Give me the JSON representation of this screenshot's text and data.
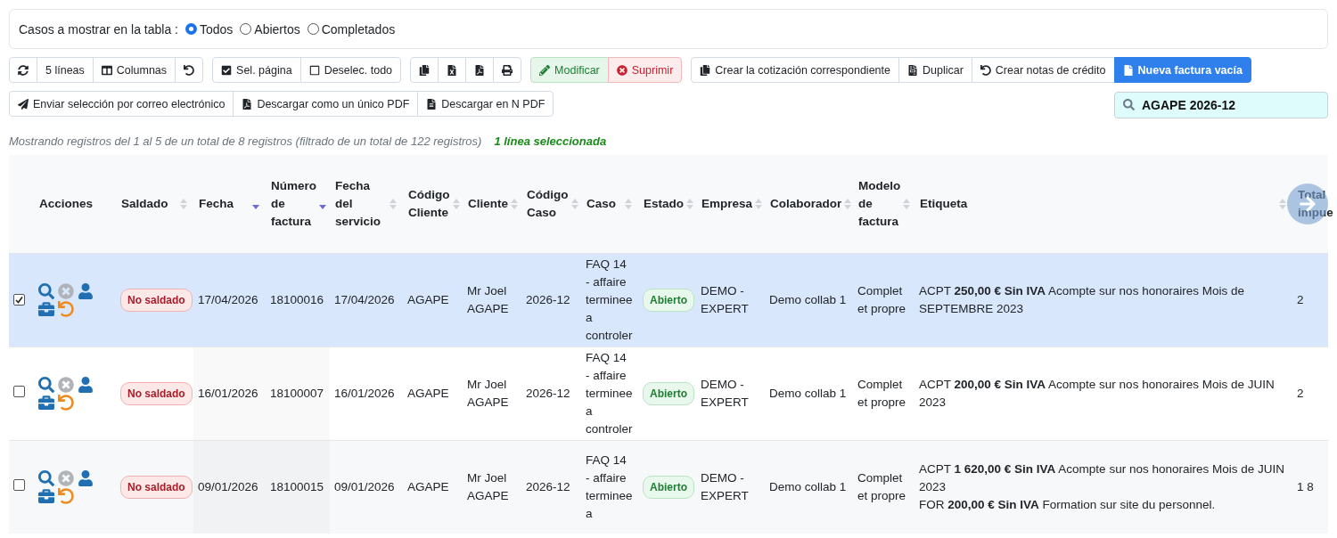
{
  "filter": {
    "label": "Casos a mostrar en la tabla :",
    "options": [
      {
        "label": "Todos",
        "selected": true
      },
      {
        "label": "Abiertos",
        "selected": false
      },
      {
        "label": "Completados",
        "selected": false
      }
    ]
  },
  "toolbar_row_1": [
    {
      "buttons": [
        {
          "kind": "plain"
        },
        {
          "kind": "plain",
          "label": "5 líneas"
        },
        {
          "kind": "plain",
          "label": "Columnas"
        },
        {
          "kind": "plain"
        }
      ]
    },
    {
      "buttons": [
        {
          "kind": "plain",
          "label": "Sel. página"
        },
        {
          "kind": "plain",
          "label": "Deselec. todo"
        }
      ]
    },
    {
      "buttons": [
        {
          "kind": "plain"
        },
        {
          "kind": "plain"
        },
        {
          "kind": "plain"
        },
        {
          "kind": "plain"
        }
      ]
    },
    {
      "buttons": [
        {
          "kind": "success",
          "label": "Modificar"
        },
        {
          "kind": "danger",
          "label": "Suprimir"
        }
      ]
    },
    {
      "buttons": [
        {
          "kind": "plain",
          "label": "Crear la cotización correspondiente"
        },
        {
          "kind": "plain",
          "label": "Duplicar"
        },
        {
          "kind": "plain",
          "label": "Crear notas de crédito"
        },
        {
          "kind": "primary",
          "label": "Nueva factura vacía"
        }
      ]
    }
  ],
  "toolbar_row_2": [
    {
      "buttons": [
        {
          "label": "Enviar selección por correo electrónico"
        },
        {
          "label": "Descargar como un único PDF"
        },
        {
          "label": "Descargar en N PDF"
        }
      ]
    }
  ],
  "search": {
    "value": "AGAPE 2026-12"
  },
  "info": "Mostrando registros del 1 al 5 de un total de 8 registros (filtrado de un total de 122 registros)",
  "selection_info": "1 línea seleccionada",
  "table": {
    "columns": [
      {
        "label": "Acciones",
        "sortable": false
      },
      {
        "label": "Saldado",
        "sortable": true,
        "sorted": false
      },
      {
        "label": "Fecha",
        "sortable": true,
        "sorted": true
      },
      {
        "label": "Número de factura",
        "sortable": true,
        "sorted": true
      },
      {
        "label": "Fecha del servicio",
        "sortable": true,
        "sorted": false
      },
      {
        "label": "Código Cliente",
        "sortable": true,
        "sorted": false
      },
      {
        "label": "Cliente",
        "sortable": true,
        "sorted": false
      },
      {
        "label": "Código Caso",
        "sortable": true,
        "sorted": false
      },
      {
        "label": "Caso",
        "sortable": true,
        "sorted": false
      },
      {
        "label": "Estado",
        "sortable": true,
        "sorted": false
      },
      {
        "label": "Empresa",
        "sortable": true,
        "sorted": false
      },
      {
        "label": "Colaborador",
        "sortable": true,
        "sorted": false
      },
      {
        "label": "Modelo de factura",
        "sortable": true,
        "sorted": false
      },
      {
        "label": "Etiqueta",
        "sortable": true,
        "sorted": false
      },
      {
        "label": "Total impue",
        "sortable": false
      }
    ],
    "rows": [
      {
        "selected": true,
        "checked": true,
        "saldado": "No saldado",
        "fecha": "17/04/2026",
        "numero": "18100016",
        "fecha_servicio": "17/04/2026",
        "codigo_cliente": "AGAPE",
        "cliente": "Mr Joel AGAPE",
        "codigo_caso": "2026-12",
        "caso": "FAQ 14 - affaire terminee a controler",
        "estado": "Abierto",
        "empresa": "DEMO - EXPERT",
        "colaborador": "Demo collab 1",
        "modelo": "Complet et propre",
        "etiqueta": [
          "ACPT **250,00 € Sin IVA** Acompte sur nos honoraires Mois de SEPTEMBRE 2023"
        ],
        "total": "2"
      },
      {
        "selected": false,
        "checked": false,
        "saldado": "No saldado",
        "fecha": "16/01/2026",
        "numero": "18100007",
        "fecha_servicio": "16/01/2026",
        "codigo_cliente": "AGAPE",
        "cliente": "Mr Joel AGAPE",
        "codigo_caso": "2026-12",
        "caso": "FAQ 14 - affaire terminee a controler",
        "estado": "Abierto",
        "empresa": "DEMO - EXPERT",
        "colaborador": "Demo collab 1",
        "modelo": "Complet et propre",
        "etiqueta": [
          "ACPT **200,00 € Sin IVA** Acompte sur nos honoraires Mois de JUIN 2023"
        ],
        "total": "2"
      },
      {
        "selected": false,
        "checked": false,
        "saldado": "No saldado",
        "fecha": "09/01/2026",
        "numero": "18100015",
        "fecha_servicio": "09/01/2026",
        "codigo_cliente": "AGAPE",
        "cliente": "Mr Joel AGAPE",
        "codigo_caso": "2026-12",
        "caso": "FAQ 14 - affaire terminee a",
        "estado": "Abierto",
        "empresa": "DEMO - EXPERT",
        "colaborador": "Demo collab 1",
        "modelo": "Complet et propre",
        "etiqueta": [
          "ACPT **1 620,00 € Sin IVA** Acompte sur nos honoraires Mois de JUIN 2023",
          "FOR **200,00 € Sin IVA** Formation sur site du personnel."
        ],
        "total": "1 8"
      }
    ]
  }
}
